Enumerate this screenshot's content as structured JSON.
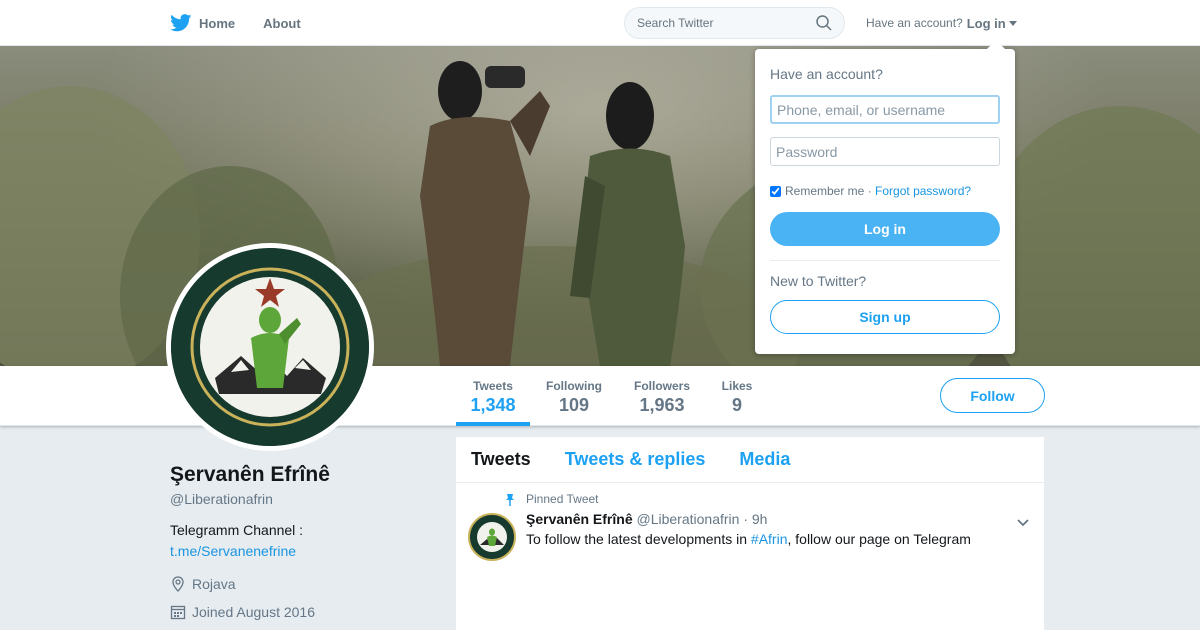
{
  "nav": {
    "home_label": "Home",
    "about_label": "About",
    "search_placeholder": "Search Twitter",
    "account_prompt": "Have an account?",
    "login_label": "Log in"
  },
  "icons": {
    "logo": "twitter-bird-icon",
    "search": "search-icon",
    "caret": "chevron-down-icon",
    "location": "location-pin-icon",
    "calendar": "calendar-icon",
    "pin": "pin-icon"
  },
  "colors": {
    "brand": "#1da1f2",
    "link": "#1b95e0",
    "login_button": "#4ab3f4",
    "text_secondary": "#657786"
  },
  "profile": {
    "name": "Şervanên Efrînê",
    "handle": "@Liberationafrin",
    "bio": "Telegramm Channel :",
    "link": "t.me/Servanenefrine",
    "location": "Rojava",
    "joined": "Joined August 2016"
  },
  "stats": [
    {
      "label": "Tweets",
      "value": "1,348",
      "active": true
    },
    {
      "label": "Following",
      "value": "109",
      "active": false
    },
    {
      "label": "Followers",
      "value": "1,963",
      "active": false
    },
    {
      "label": "Likes",
      "value": "9",
      "active": false
    }
  ],
  "follow_label": "Follow",
  "timeline": {
    "tabs": [
      "Tweets",
      "Tweets & replies",
      "Media"
    ],
    "active_tab": "Tweets",
    "pinned_label": "Pinned Tweet",
    "tweet": {
      "author": "Şervanên Efrînê",
      "handle": "@Liberationafrin",
      "separator": "·",
      "time": "9h",
      "text_before": "To follow the latest developments in ",
      "hashtag": "#Afrin",
      "text_after": ", follow our page on Telegram"
    }
  },
  "login_dropdown": {
    "title": "Have an account?",
    "username_placeholder": "Phone, email, or username",
    "password_placeholder": "Password",
    "remember_label": "Remember me",
    "separator": "·",
    "forgot_label": "Forgot password?",
    "remember_checked": true,
    "login_button": "Log in",
    "new_prompt": "New to Twitter?",
    "signup_button": "Sign up"
  }
}
